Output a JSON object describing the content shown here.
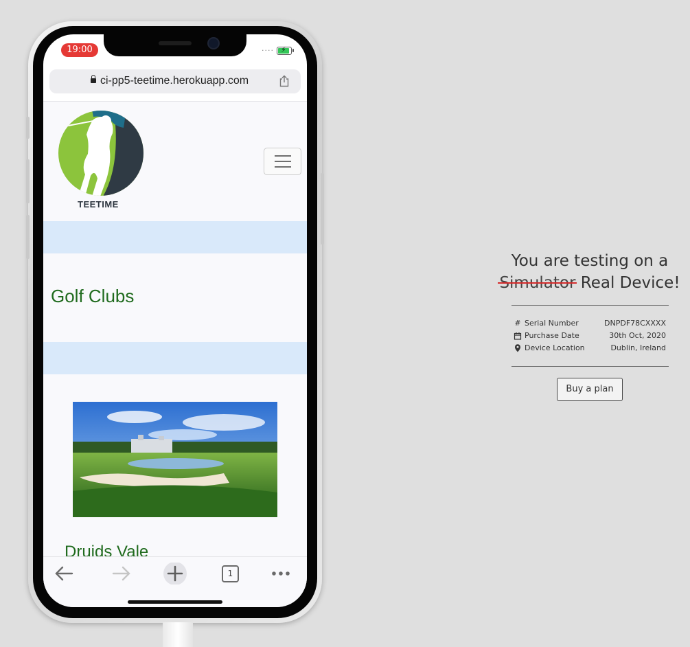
{
  "status_bar": {
    "time": "19:00",
    "signal": "...."
  },
  "browser": {
    "url": "ci-pp5-teetime.herokuapp.com"
  },
  "site": {
    "logo_text": "TEETIME",
    "section_title": "Golf Clubs",
    "club_name": "Druids Vale"
  },
  "toolbar": {
    "tab_count": "1"
  },
  "info_panel": {
    "title_line1": "You are testing on a",
    "struck_word": "Simulator",
    "title_rest": " Real Device!",
    "rows": [
      {
        "icon": "hash-icon",
        "label": "Serial Number",
        "value": "DNPDF78CXXXX"
      },
      {
        "icon": "calendar-icon",
        "label": "Purchase Date",
        "value": "30th Oct, 2020"
      },
      {
        "icon": "location-pin-icon",
        "label": "Device Location",
        "value": "Dublin, Ireland"
      }
    ],
    "button_label": "Buy a plan"
  },
  "colors": {
    "accent_green": "#206b1e",
    "band_blue": "#d9e9fa",
    "status_red": "#e53935",
    "strike_red": "#d42b2b"
  }
}
